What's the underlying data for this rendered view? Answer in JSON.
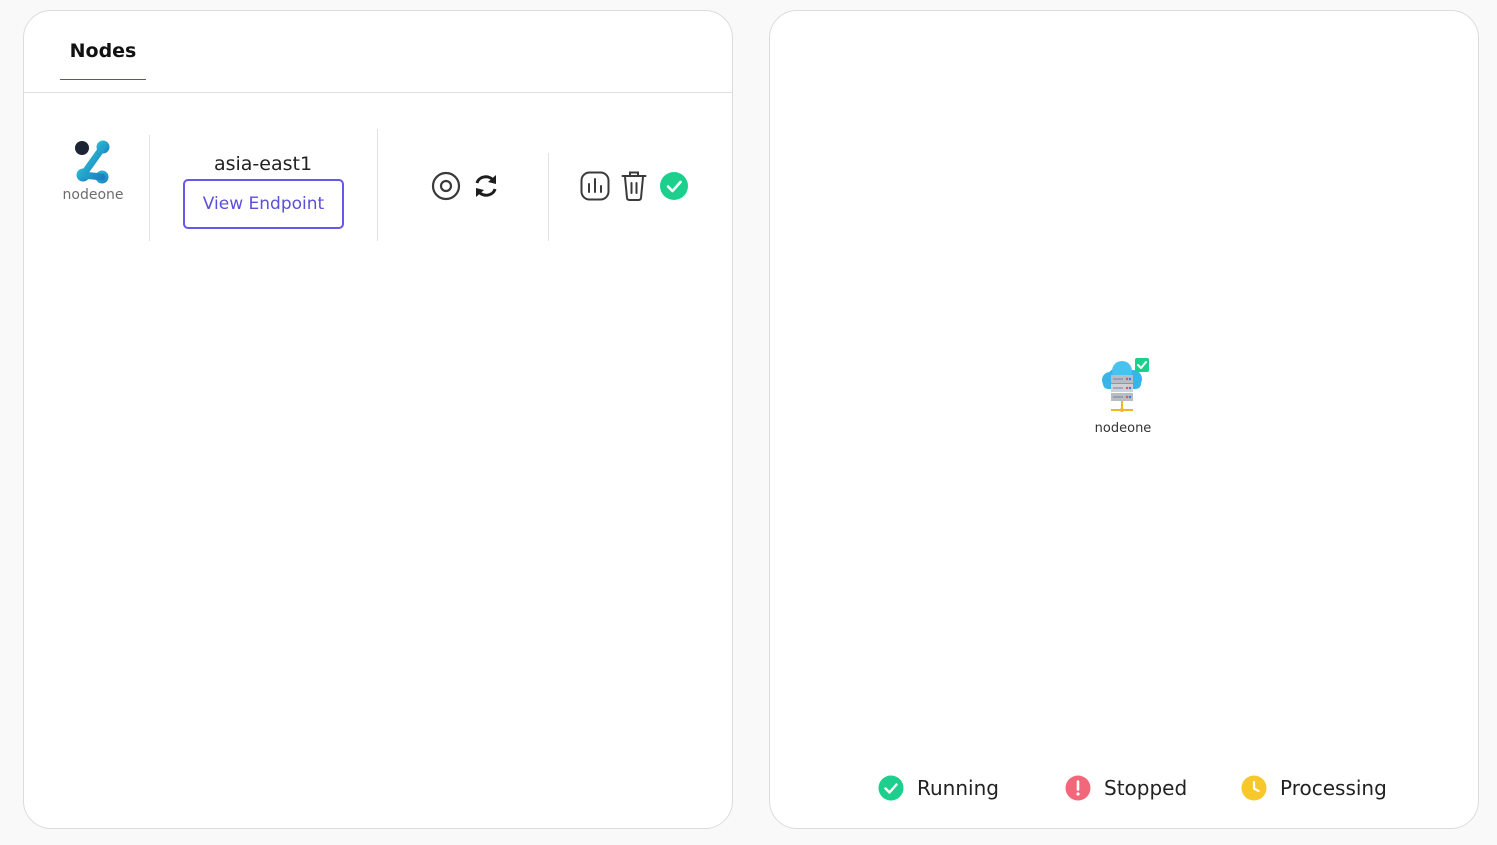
{
  "tabs": [
    {
      "label": "Nodes"
    }
  ],
  "node": {
    "name": "nodeone",
    "region": "asia-east1",
    "endpoint_button": "View Endpoint",
    "status": "running"
  },
  "map": {
    "node_label": "nodeone"
  },
  "legend": [
    {
      "label": "Running",
      "color": "#1ccf8c",
      "icon": "check-circle-icon"
    },
    {
      "label": "Stopped",
      "color": "#f2677a",
      "icon": "exclamation-circle-icon"
    },
    {
      "label": "Processing",
      "color": "#f7c72b",
      "icon": "clock-circle-icon"
    }
  ],
  "colors": {
    "accent": "#5a45d6",
    "running": "#1ccf8c",
    "stopped": "#f2677a",
    "processing": "#f7c72b"
  },
  "icons": {
    "logo": "nodeone-logo-icon",
    "stop": "stop-icon",
    "restart": "refresh-icon",
    "metrics": "bar-chart-icon",
    "delete": "trash-icon",
    "status": "check-circle-icon",
    "map_node": "cloud-server-icon"
  }
}
